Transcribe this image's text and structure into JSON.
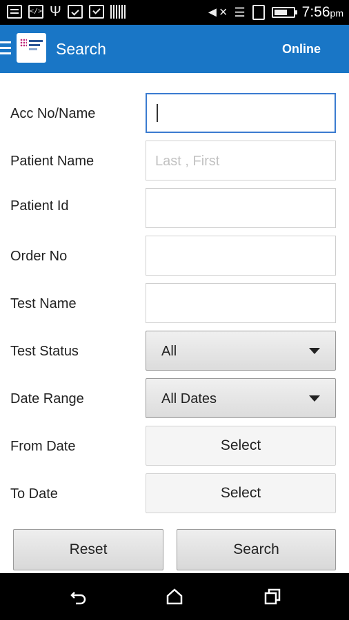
{
  "status_bar": {
    "time": "7:56",
    "ampm": "pm",
    "icons": [
      "image-icon",
      "code-icon",
      "usb-icon",
      "clipboard-check-icon",
      "checkbox-icon",
      "barcode-icon",
      "mute-icon",
      "wifi-icon",
      "sim-icon",
      "battery-icon"
    ]
  },
  "header": {
    "title": "Search",
    "status": "Online",
    "accent": "#1976c6"
  },
  "form": {
    "acc_label": "Acc No/Name",
    "acc_value": "",
    "patient_name_label": "Patient Name",
    "patient_name_placeholder": "Last , First",
    "patient_id_label": "Patient Id",
    "order_no_label": "Order No",
    "test_name_label": "Test Name",
    "test_status_label": "Test Status",
    "test_status_value": "All",
    "date_range_label": "Date Range",
    "date_range_value": "All Dates",
    "from_date_label": "From Date",
    "from_date_button": "Select",
    "to_date_label": "To Date",
    "to_date_button": "Select"
  },
  "actions": {
    "reset": "Reset",
    "search": "Search"
  },
  "navbar": {
    "icons": [
      "back-icon",
      "home-icon",
      "recent-apps-icon"
    ]
  }
}
